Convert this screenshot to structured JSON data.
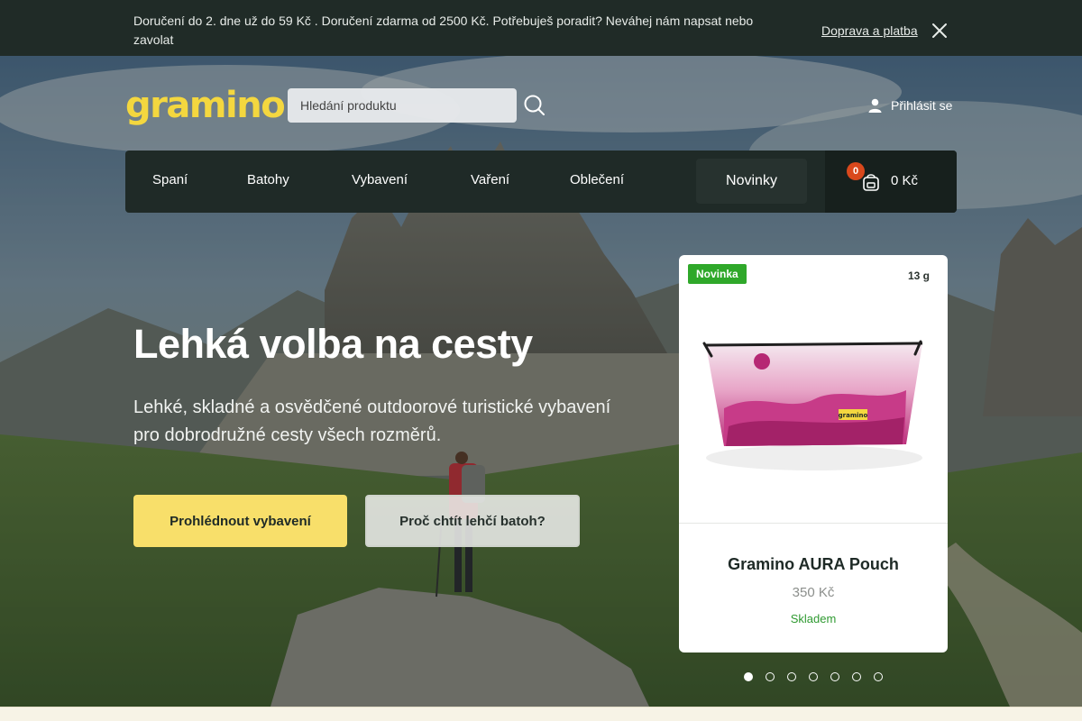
{
  "announcement": {
    "message": "Doručení do 2. dne už do 59 Kč . Doručení zdarma od 2500 Kč. Potřebuješ poradit? Neváhej nám napsat nebo zavolat ",
    "link": "Doprava a platba"
  },
  "header": {
    "logo": "gramino",
    "search_placeholder": "Hledání produktu",
    "login": "Přihlásit se"
  },
  "nav": {
    "items": [
      "Spaní",
      "Batohy",
      "Vybavení",
      "Vaření",
      "Oblečení"
    ],
    "highlight": "Novinky",
    "cart_count": "0",
    "cart_price": "0 Kč"
  },
  "hero": {
    "title": "Lehká volba na cesty",
    "subtitle": "Lehké, skladné a osvědčené outdoorové turistické vybavení pro dobrodružné cesty všech rozměrů.",
    "primary_button": "Prohlédnout vybavení",
    "secondary_button": "Proč chtít lehčí batoh?"
  },
  "product": {
    "badge": "Novinka",
    "weight": "13 g",
    "name": "Gramino AURA Pouch",
    "price": "350 Kč",
    "stock": "Skladem",
    "print_label": "gramino"
  },
  "carousel": {
    "total": 7,
    "active": 1
  },
  "colors": {
    "dark": "#202b27",
    "accent_yellow": "#f4d73f",
    "button_yellow": "#f8df6a",
    "badge_green": "#2fa82a",
    "cart_badge": "#d9481c"
  }
}
